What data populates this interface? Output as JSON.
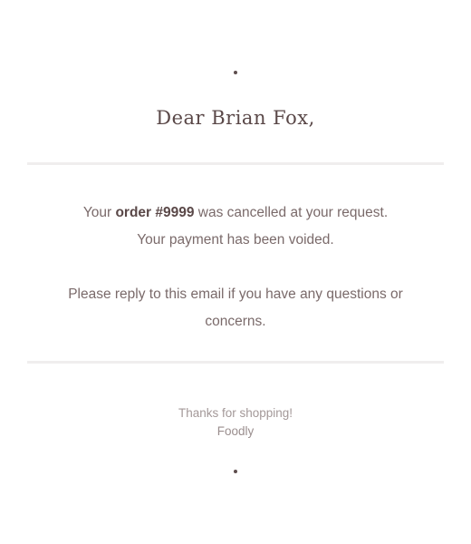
{
  "greeting": "Dear Brian Fox,",
  "message": {
    "line1_prefix": "Your ",
    "order_ref": "order #9999",
    "line1_suffix": " was cancelled at your request.",
    "line2": "Your payment has been voided.",
    "line3": "Please reply to this email if you have any questions or concerns."
  },
  "footer": {
    "thanks": "Thanks for shopping!",
    "brand": "Foodly"
  }
}
